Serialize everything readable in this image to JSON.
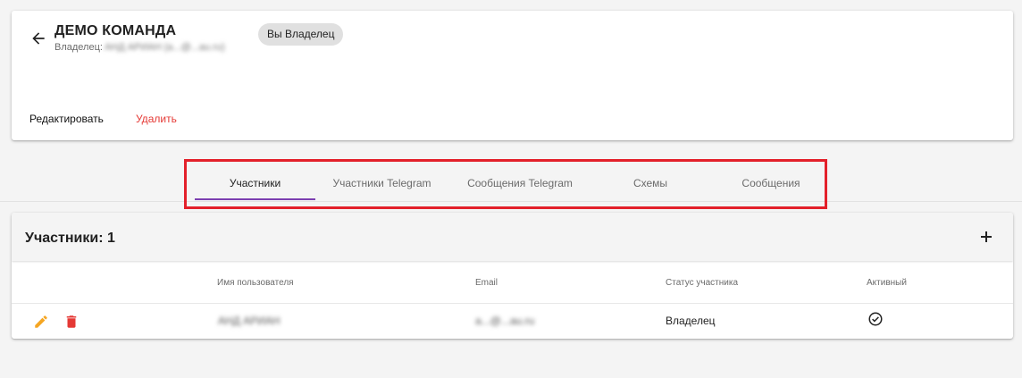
{
  "team": {
    "title": "ДЕМО КОМАНДА",
    "owner_label": "Владелец:",
    "owner_value": "АНД АРИАН (a...@...au.ru)",
    "owner_chip": "Вы Владелец",
    "actions": {
      "edit": "Редактировать",
      "delete": "Удалить"
    }
  },
  "tabs": [
    {
      "label": "Участники",
      "active": true
    },
    {
      "label": "Участники Telegram",
      "active": false
    },
    {
      "label": "Сообщения Telegram",
      "active": false
    },
    {
      "label": "Схемы",
      "active": false
    },
    {
      "label": "Сообщения",
      "active": false
    }
  ],
  "members": {
    "title": "Участники: 1",
    "columns": [
      "Имя пользователя",
      "Email",
      "Статус участника",
      "Активный"
    ],
    "rows": [
      {
        "username": "АНД АРИАН",
        "email": "a...@...au.ru",
        "status": "Владелец",
        "active": true
      }
    ]
  },
  "colors": {
    "accent": "#7b3fb0",
    "danger": "#e53935",
    "edit_icon": "#f5a623",
    "highlight": "#e3202a"
  },
  "icons": [
    "arrow-back-icon",
    "add-icon",
    "pencil-icon",
    "trash-icon",
    "check-circle-icon"
  ]
}
